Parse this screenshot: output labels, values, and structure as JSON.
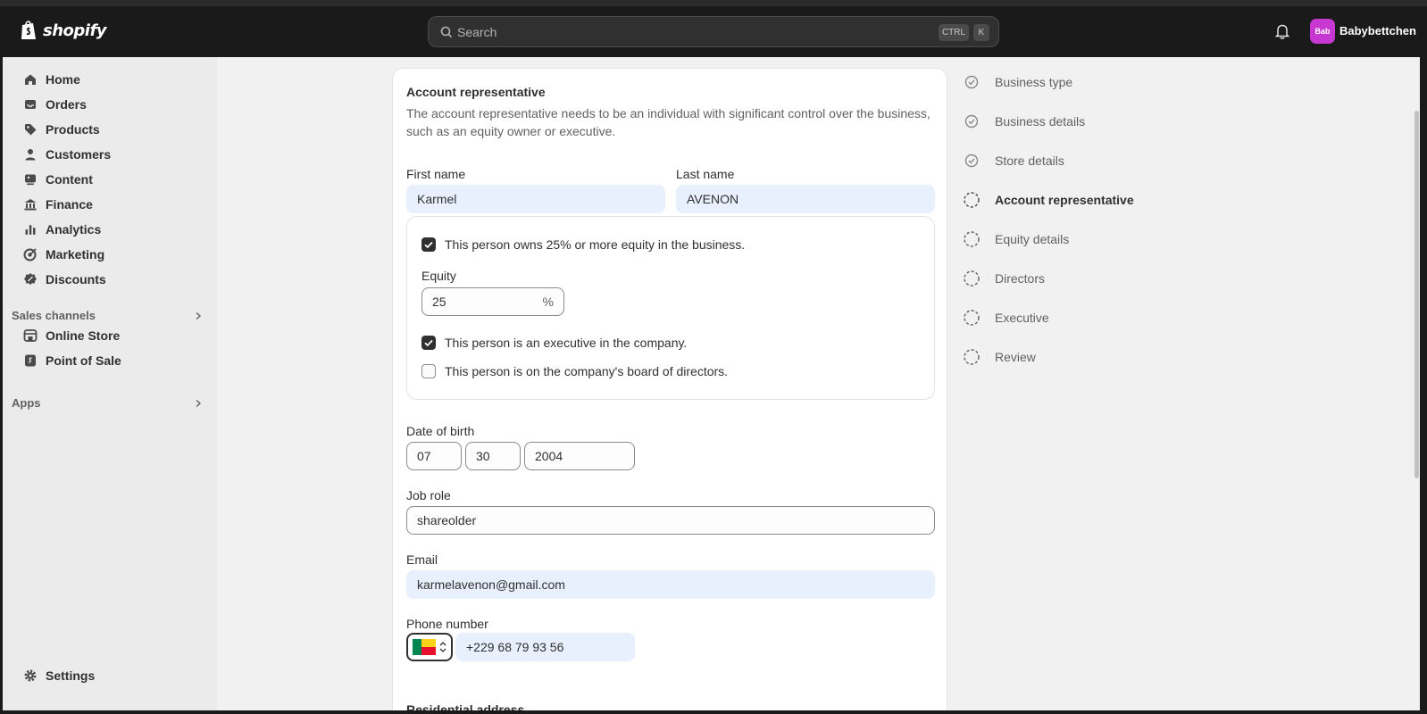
{
  "app": {
    "brand": "shopify",
    "store_name": "Babybettchen",
    "avatar_initials": "Bab"
  },
  "search": {
    "placeholder": "Search",
    "shortcut_ctrl": "CTRL",
    "shortcut_k": "K"
  },
  "sidebar": {
    "items": [
      {
        "label": "Home",
        "icon": "home-icon"
      },
      {
        "label": "Orders",
        "icon": "inbox-icon"
      },
      {
        "label": "Products",
        "icon": "tag-icon"
      },
      {
        "label": "Customers",
        "icon": "person-icon"
      },
      {
        "label": "Content",
        "icon": "image-icon"
      },
      {
        "label": "Finance",
        "icon": "bank-icon"
      },
      {
        "label": "Analytics",
        "icon": "bar-chart-icon"
      },
      {
        "label": "Marketing",
        "icon": "target-icon"
      },
      {
        "label": "Discounts",
        "icon": "discount-icon"
      }
    ],
    "sales_channels_title": "Sales channels",
    "sales_channels": [
      {
        "label": "Online Store",
        "icon": "store-icon"
      },
      {
        "label": "Point of Sale",
        "icon": "pos-icon"
      }
    ],
    "apps_title": "Apps",
    "settings_label": "Settings"
  },
  "form": {
    "title": "Account representative",
    "description": "The account representative needs to be an individual with significant control over the business, such as an equity owner or executive.",
    "first_name_label": "First name",
    "first_name": "Karmel",
    "last_name_label": "Last name",
    "last_name": "AVENON",
    "equity_checkbox_label": "This person owns 25% or more equity in the business.",
    "equity_checked": true,
    "equity_label": "Equity",
    "equity_value": "25",
    "equity_suffix": "%",
    "executive_checkbox_label": "This person is an executive in the company.",
    "executive_checked": true,
    "board_checkbox_label": "This person is on the company's board of directors.",
    "board_checked": false,
    "dob_label": "Date of birth",
    "dob_month": "07",
    "dob_day": "30",
    "dob_year": "2004",
    "job_role_label": "Job role",
    "job_role": "shareolder",
    "email_label": "Email",
    "email": "karmelavenon@gmail.com",
    "phone_label": "Phone number",
    "phone": "+229 68 79 93 56",
    "residential_title": "Residential address"
  },
  "steps": [
    {
      "label": "Business type",
      "state": "done"
    },
    {
      "label": "Business details",
      "state": "done"
    },
    {
      "label": "Store details",
      "state": "done"
    },
    {
      "label": "Account representative",
      "state": "current"
    },
    {
      "label": "Equity details",
      "state": "pending"
    },
    {
      "label": "Directors",
      "state": "pending"
    },
    {
      "label": "Executive",
      "state": "pending"
    },
    {
      "label": "Review",
      "state": "pending"
    }
  ],
  "colors": {
    "topbar": "#1a1a1a",
    "filled_input": "#e8effd",
    "avatar": "#c737d1"
  }
}
